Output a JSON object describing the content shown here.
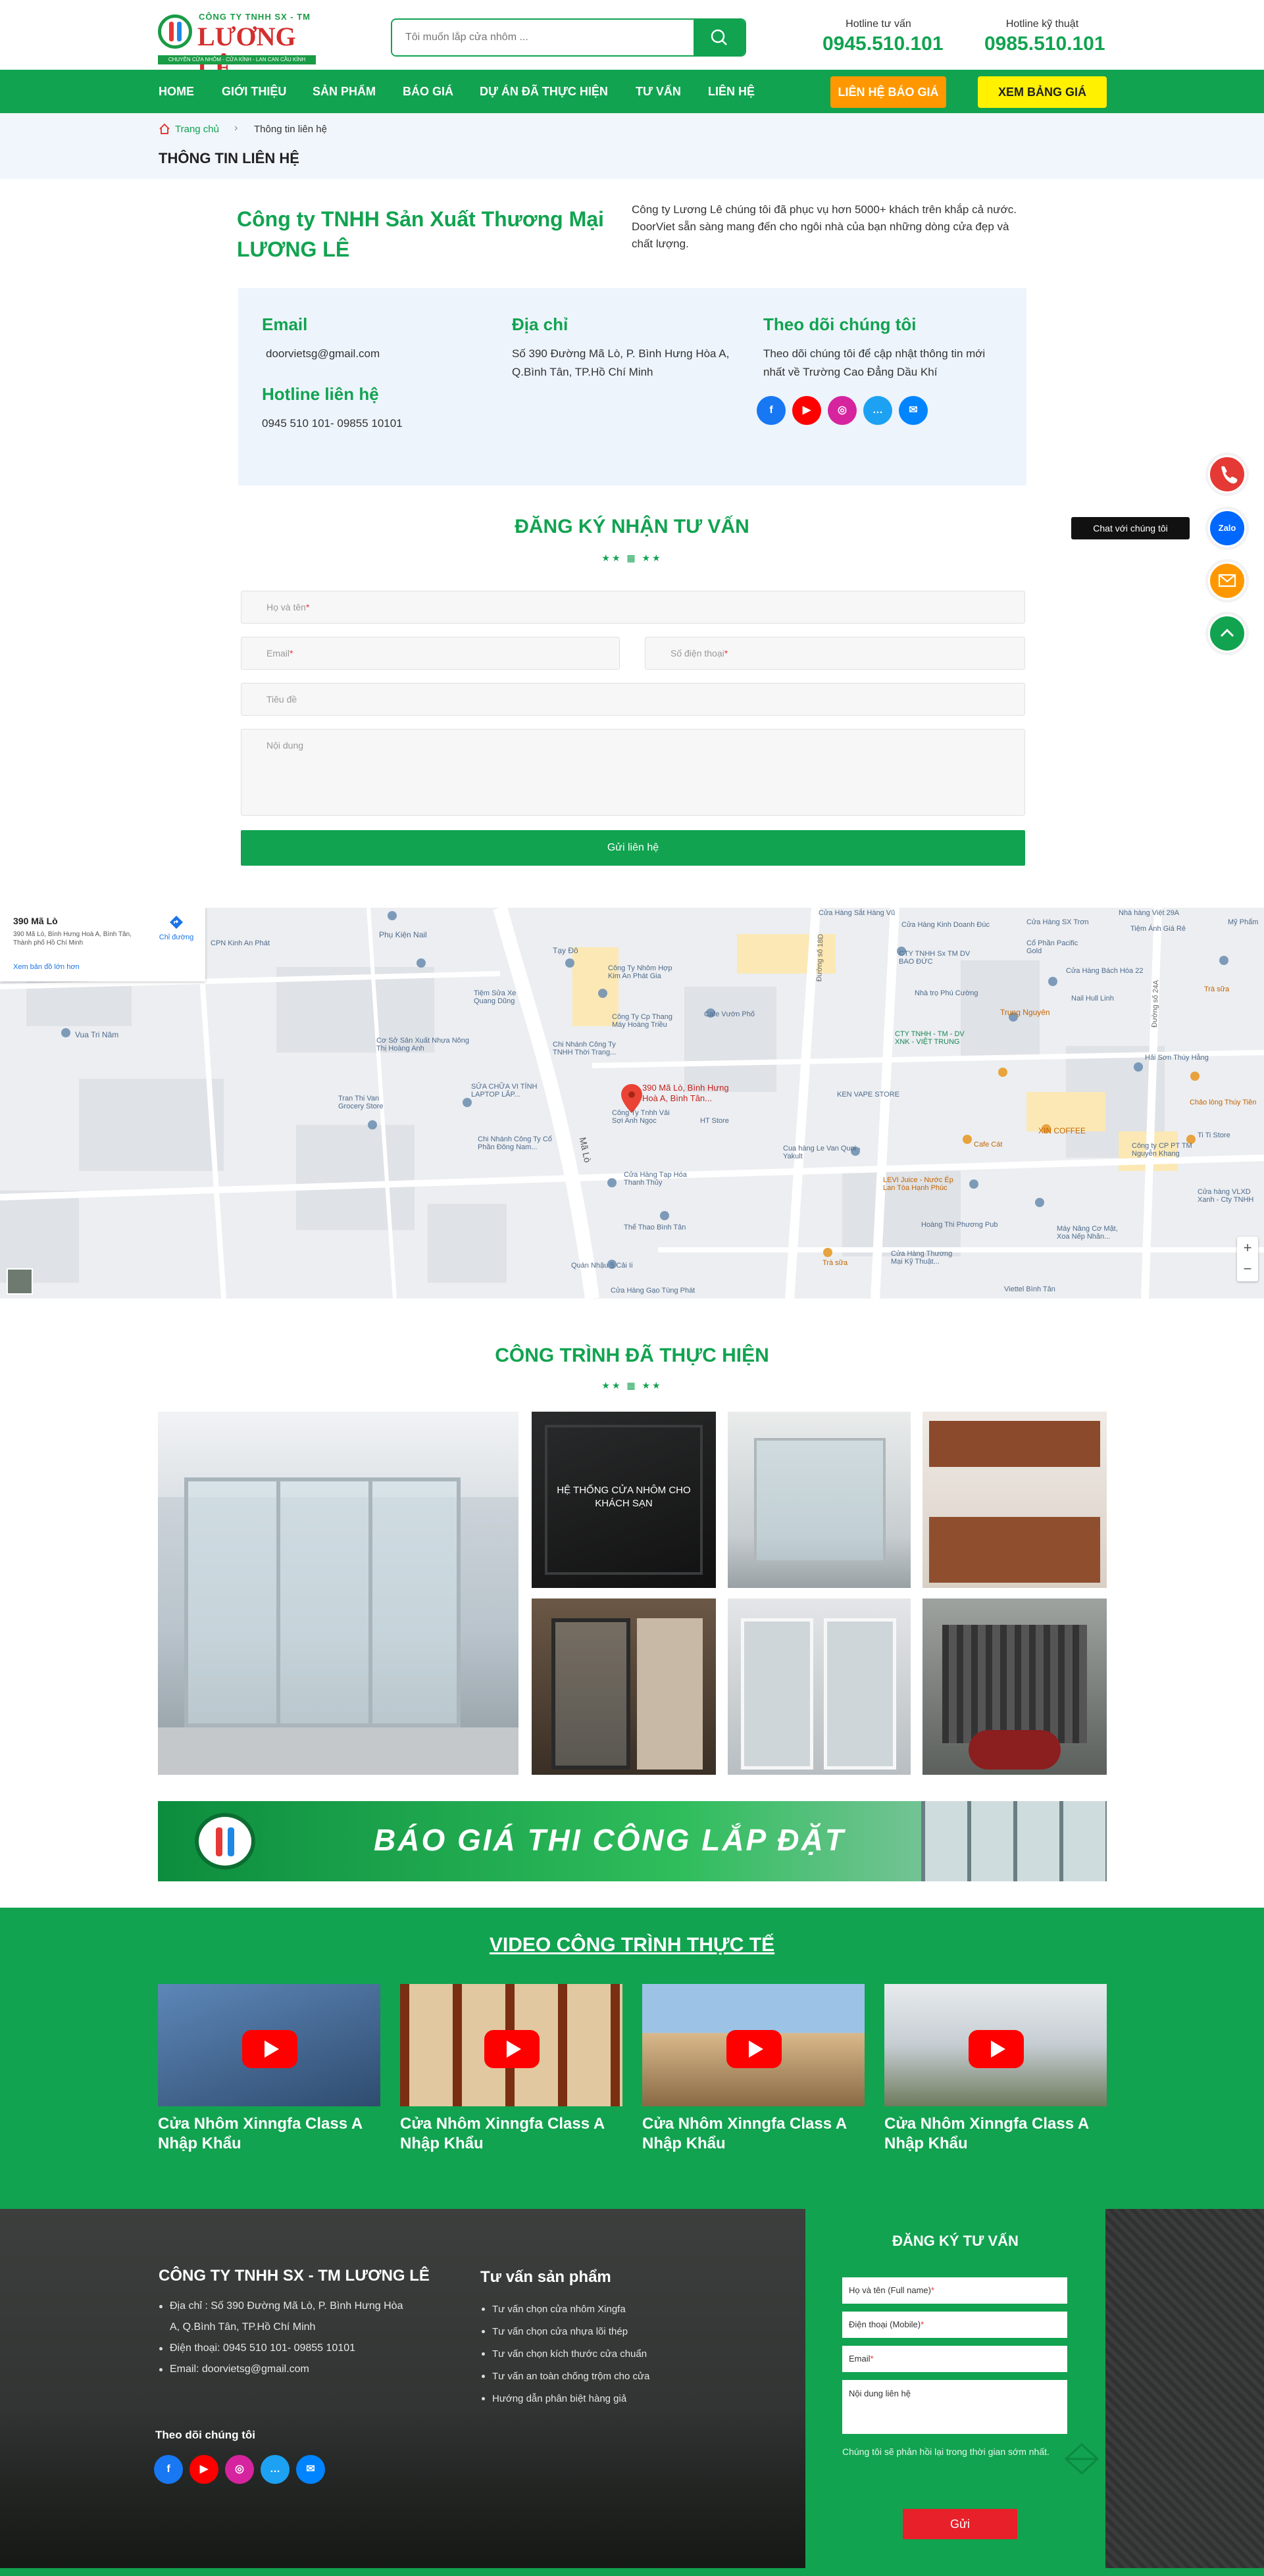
{
  "header": {
    "logo": {
      "small": "CÔNG TY TNHH SX - TM",
      "big": "LƯƠNG LÊ",
      "tagline": "CHUYÊN CỬA NHÔM - CỬA KÍNH - LAN CAN CẦU KÍNH"
    },
    "search_placeholder": "Tôi muốn lắp cửa nhôm ...",
    "hotline_label": "Hotline tư vấn",
    "hotline_value": "0945.510.101",
    "tech_label": "Hotline kỹ thuật",
    "tech_value": "0985.510.101"
  },
  "nav": {
    "items": [
      "HOME",
      "GIỚI THIỆU",
      "SẢN PHẨM",
      "BÁO GIÁ",
      "DỰ ÁN ĐÃ THỰC HIỆN",
      "TƯ VẤN",
      "LIÊN HỆ"
    ],
    "contact_btn": "LIÊN HỆ BÁO GIÁ",
    "price_btn": "XEM BẢNG GIÁ"
  },
  "breadcrumb": {
    "home": "Trang chủ",
    "current": "Thông tin liên hệ",
    "title": "THÔNG TIN LIÊN HỆ"
  },
  "company": {
    "name": "Công ty TNHH Sản Xuất Thương Mại LƯƠNG LÊ",
    "intro": "Công ty Lương Lê chúng tôi đã phục vụ hơn 5000+ khách trên khắp cả nước. DoorViet sẵn sàng mang đến cho ngôi nhà của bạn những dòng cửa đẹp và chất lượng."
  },
  "contact": {
    "email_h": "Email",
    "email": "doorvietsg@gmail.com",
    "hotline_h": "Hotline liên hệ",
    "hotline": "0945 510 101- 09855 10101",
    "addr_h": "Địa chỉ",
    "addr": "Số 390 Đường Mã Lò, P. Bình Hưng Hòa A, Q.Bình Tân, TP.Hồ Chí Minh",
    "follow_h": "Theo dõi chúng tôi",
    "follow": "Theo dõi chúng tôi để cập nhật thông tin mới nhất về Trường Cao Đẳng Dầu Khí"
  },
  "form": {
    "title": "ĐĂNG KÝ NHẬN TƯ VẤN",
    "stars": "★★ ▦ ★★",
    "name": "Họ và tên",
    "email": "Email",
    "phone": "Số điện thoại",
    "subject": "Tiêu đề",
    "content": "Nội dung",
    "submit": "Gửi liên hệ",
    "req": "*"
  },
  "map": {
    "card_title": "390 Mã Lò",
    "card_addr": "390 Mã Lò, Bình Hưng Hoà A, Bình Tân, Thành phố Hồ Chí Minh",
    "directions": "Chỉ đường",
    "larger": "Xem bản đồ lớn hơn",
    "pin": "390 Mã Lò, Bình Hưng Hoà A, Bình Tân...",
    "road": "Mã Lò",
    "labels": [
      "Phụ Kiện Nail",
      "Tạy Đô",
      "Tiệm Sửa Xe Quang Dũng",
      "Công Ty Nhôm Hợp Kim An Phát Gia",
      "Công Ty Cp Thang Máy Hoàng Triều",
      "Cafe Vườn Phố",
      "Chi Nhánh Công Ty TNHH Thời Trang...",
      "Cơ Sở Sản Xuất Nhựa Nông Thị Hoàng Anh",
      "Vua Tri Nâm",
      "Tran Thi Van Grocery Store",
      "SỬA CHỮA VI TÍNH LAPTOP LẮP...",
      "Chi Nhánh Công Ty Cổ Phần Đông Nam...",
      "Công Ty Tnhh Vải Sợi Anh Ngọc",
      "Cửa Hàng Tạp Hóa Thanh Thủy",
      "Thể Thao Bình Tân",
      "Quán Nhậu 5 Cải Ii",
      "Cửa Hàng Gạo Tùng Phát",
      "HT Store",
      "Cua hàng Le Van Quoi - Yakult",
      "KEN VAPE STORE",
      "CTY TNHH - TM - DV XNK - VIỆT TRUNG",
      "Nhà trọ Phú Cường",
      "Trung Nguyên",
      "Nail Hull Linh",
      "Cửa Hàng Bách Hóa 22",
      "Cổ Phần Pacific Gold",
      "Hải Sơn Thúy Hằng",
      "Tiệm Ánh Giá Rẻ",
      "Mỹ Phẩm",
      "Trà sữa",
      "XIN COFFEE",
      "Cafe Cát",
      "LEVI Juice - Nước Ép Lan Tòa Hạnh Phúc",
      "Hoàng Thi Phương Pub",
      "Công ty CP PT TM Nguyễn Khang",
      "Ti Ti Store",
      "Cửa hàng VLXD Xanh - Cty TNHH",
      "Chảo lòng Thúy Tiên",
      "Máy Nâng Cơ Mặt, Xoa Nếp Nhăn...",
      "Cửa Hàng Thương Mại Kỹ Thuật...",
      "Viettel Bình Tân",
      "Trà sữa",
      "Cửa Hàng Sắt Hàng Vũ",
      "Cửa Hàng Kinh Doanh Đúc",
      "CTY TNHH Sx TM DV BAO ĐỨC",
      "Đường số 18D",
      "Đường số 24A",
      "Nhà hàng Việt 29A",
      "CPN Kinh An Phát",
      "Cửa Hàng SX Trơn"
    ]
  },
  "projects": {
    "title": "CÔNG TRÌNH ĐÃ THỰC HIỆN",
    "stars": "★★ ▦ ★★",
    "overlay": "HỆ THỐNG CỬA NHÔM CHO KHÁCH SẠN"
  },
  "banner": {
    "text": "BÁO GIÁ THI CÔNG LẮP ĐẶT"
  },
  "videos": {
    "title": "VIDEO CÔNG TRÌNH THỰC TẾ",
    "items": [
      "Cửa Nhôm Xinngfa Class A Nhập Khẩu",
      "Cửa Nhôm Xinngfa Class A Nhập Khẩu",
      "Cửa Nhôm Xinngfa Class A Nhập Khẩu",
      "Cửa Nhôm Xinngfa Class A Nhập Khẩu"
    ]
  },
  "footer": {
    "company": "CÔNG TY TNHH SX - TM LƯƠNG LÊ",
    "lines": [
      "Địa chỉ : Số 390 Đường Mã Lò, P. Bình Hưng Hòa A, Q.Bình Tân, TP.Hồ Chí Minh",
      "Điện thoại: 0945 510 101- 09855 10101",
      "Email: doorvietsg@gmail.com"
    ],
    "advice_h": "Tư vấn sản phẩm",
    "advice": [
      "Tư vấn chọn cửa nhôm Xingfa",
      "Tư vấn chọn cửa nhựa lõi thép",
      "Tư vấn chọn kích thước cửa chuẩn",
      "Tư vấn an toàn chống trộm cho cửa",
      "Hướng dẫn phân biệt hàng giả"
    ],
    "follow_h": "Theo dõi chúng tôi",
    "form_h": "ĐĂNG KÝ TƯ VẤN",
    "f_name": "Họ và tên (Full name)",
    "f_phone": "Điện thoại (Mobile)",
    "f_email": "Email",
    "f_content": "Nội dung liên hệ",
    "req": "*",
    "note": "Chúng tôi sẽ phản hồi lại trong thời gian sớm nhất.",
    "submit": "Gửi"
  },
  "float": {
    "chat": "Chat với chúng tôi",
    "zalo": "Zalo"
  },
  "colors": {
    "brand": "#11a350",
    "orange": "#ff9800",
    "yellow": "#ffeb3b"
  }
}
